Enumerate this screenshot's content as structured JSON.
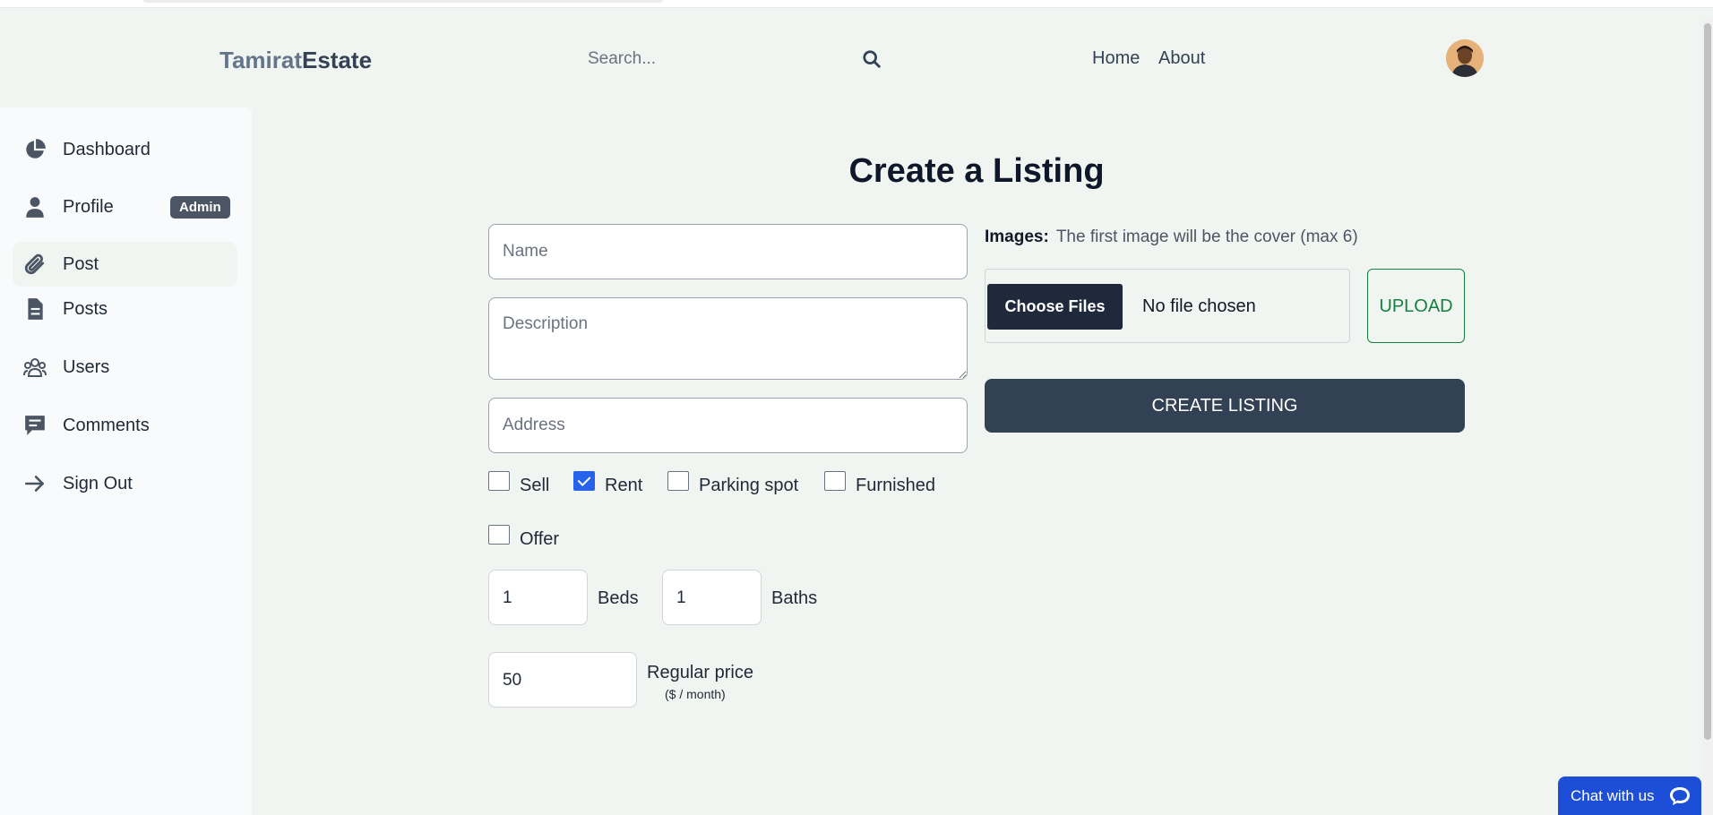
{
  "header": {
    "logo_part1": "Tamirat",
    "logo_part2": "Estate",
    "search_placeholder": "Search...",
    "nav": {
      "home": "Home",
      "about": "About"
    }
  },
  "sidebar": {
    "items": [
      {
        "label": "Dashboard",
        "icon": "pie-chart-icon"
      },
      {
        "label": "Profile",
        "icon": "user-icon",
        "badge": "Admin"
      },
      {
        "label": "Post",
        "icon": "paperclip-icon",
        "active": true
      },
      {
        "label": "Posts",
        "icon": "document-icon"
      },
      {
        "label": "Users",
        "icon": "users-icon"
      },
      {
        "label": "Comments",
        "icon": "comment-icon"
      },
      {
        "label": "Sign Out",
        "icon": "arrow-right-icon"
      }
    ]
  },
  "form": {
    "title": "Create a Listing",
    "name_placeholder": "Name",
    "description_placeholder": "Description",
    "address_placeholder": "Address",
    "checkboxes": {
      "sell": {
        "label": "Sell",
        "checked": false
      },
      "rent": {
        "label": "Rent",
        "checked": true
      },
      "parking": {
        "label": "Parking spot",
        "checked": false
      },
      "furnished": {
        "label": "Furnished",
        "checked": false
      },
      "offer": {
        "label": "Offer",
        "checked": false
      }
    },
    "beds": {
      "value": "1",
      "label": "Beds"
    },
    "baths": {
      "value": "1",
      "label": "Baths"
    },
    "price": {
      "value": "50",
      "label": "Regular price",
      "sublabel": "($ / month)"
    },
    "images_label": "Images:",
    "images_hint": "The first image will be the cover (max 6)",
    "choose_files": "Choose Files",
    "no_file": "No file chosen",
    "upload": "UPLOAD",
    "create": "CREATE LISTING"
  },
  "chat": {
    "label": "Chat with us"
  },
  "colors": {
    "primary_dark": "#334155",
    "accent_blue": "#1d4ed8",
    "upload_green": "#15803d",
    "background": "#f1f5f1"
  }
}
